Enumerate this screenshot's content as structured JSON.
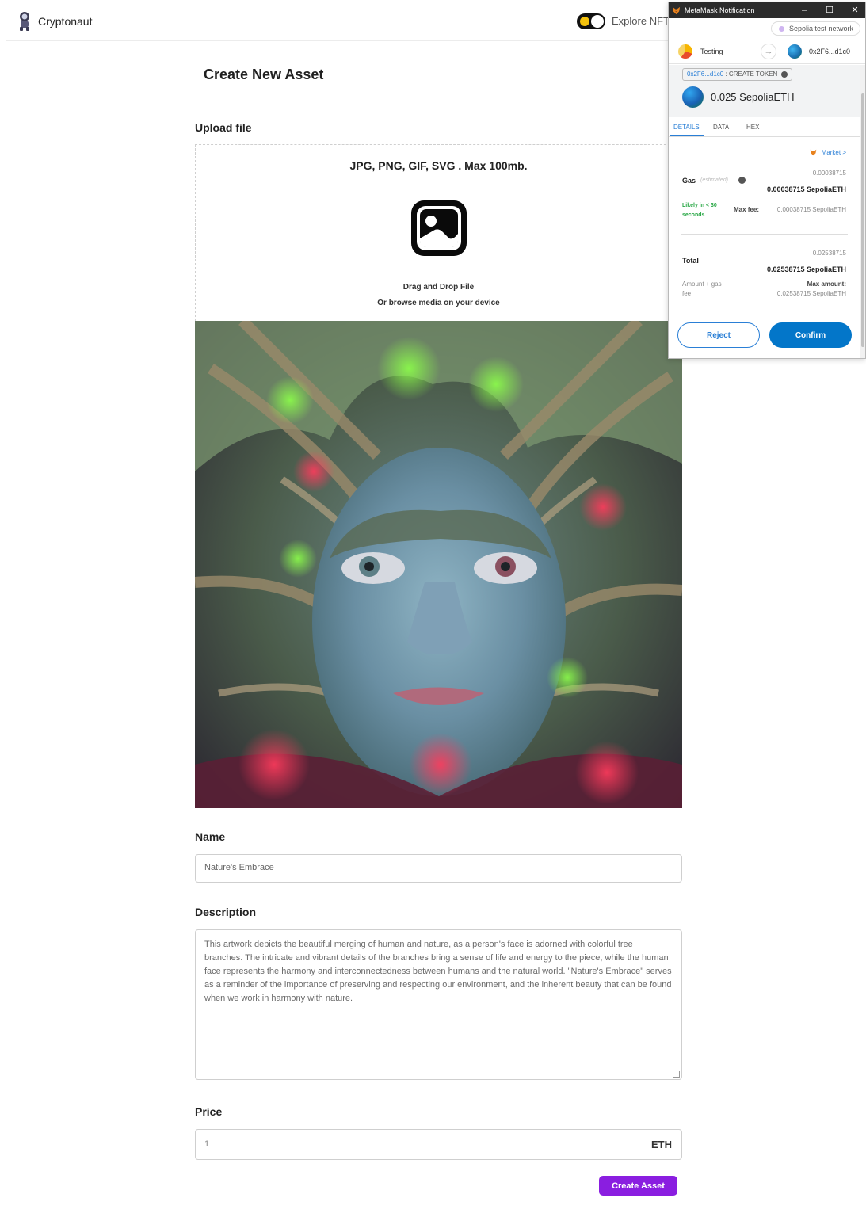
{
  "header": {
    "logo_text": "Cryptonaut",
    "explore_label": "Explore NFTs"
  },
  "form": {
    "title": "Create New Asset",
    "upload": {
      "label": "Upload file",
      "formats": "JPG, PNG, GIF, SVG . Max 100mb.",
      "drag_text": "Drag and Drop File",
      "browse_text": "Or browse media on your device"
    },
    "name": {
      "label": "Name",
      "value": "Nature's Embrace"
    },
    "description": {
      "label": "Description",
      "value": "This artwork depicts the beautiful merging of human and nature, as a person's face is adorned with colorful tree branches. The intricate and vibrant details of the branches bring a sense of life and energy to the piece, while the human face represents the harmony and interconnectedness between humans and the natural world. \"Nature's Embrace\" serves as a reminder of the importance of preserving and respecting our environment, and the inherent beauty that can be found when we work in harmony with nature."
    },
    "price": {
      "label": "Price",
      "value": "1",
      "unit": "ETH"
    },
    "submit_label": "Create Asset"
  },
  "metamask": {
    "window_title": "MetaMask Notification",
    "network": "Sepolia test network",
    "from_account": "Testing",
    "to_address": "0x2F6...d1c0",
    "method_address": "0x2F6...d1c0",
    "method_name": ": CREATE TOKEN",
    "amount": "0.025 SepoliaETH",
    "tabs": [
      "DETAILS",
      "DATA",
      "HEX"
    ],
    "market_label": "Market >",
    "gas": {
      "label": "Gas",
      "estimated_label": "(estimated)",
      "small_value": "0.00038715",
      "value": "0.00038715 SepoliaETH",
      "likely_line1": "Likely in < 30",
      "likely_line2": "seconds",
      "max_fee_label": "Max fee:",
      "max_fee_value": "0.00038715 SepoliaETH"
    },
    "total": {
      "label": "Total",
      "small_value": "0.02538715",
      "value": "0.02538715 SepoliaETH",
      "sub_line1": "Amount + gas",
      "sub_line2": "fee",
      "max_amount_label": "Max amount:",
      "max_amount_value": "0.02538715 SepoliaETH"
    },
    "reject_label": "Reject",
    "confirm_label": "Confirm"
  },
  "colors": {
    "accent": "#8a1ee0",
    "metamask_blue": "#0376c9",
    "likely_green": "#28a745"
  }
}
